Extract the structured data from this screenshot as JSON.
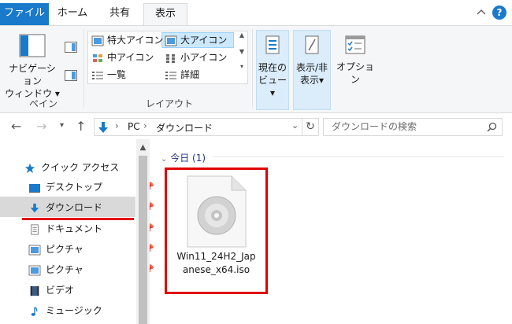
{
  "ribbon_tabs": {
    "file": "ファイル",
    "home": "ホーム",
    "share": "共有",
    "view": "表示"
  },
  "help_label": "?",
  "pane_group": {
    "nav_pane_line1": "ナビゲーション",
    "nav_pane_line2": "ウィンドウ",
    "label": "ペイン"
  },
  "layout_group": {
    "extra_large_icons": "特大アイコン",
    "large_icons": "大アイコン",
    "medium_icons": "中アイコン",
    "small_icons": "小アイコン",
    "list": "一覧",
    "details": "詳細",
    "label": "レイアウト"
  },
  "current_view": {
    "line1": "現在の",
    "line2": "ビュー"
  },
  "show_hide": {
    "line1": "表示/非",
    "line2": "表示"
  },
  "options_label": "オプション",
  "address": {
    "pc": "PC",
    "folder": "ダウンロード"
  },
  "search": {
    "placeholder": "ダウンロードの検索"
  },
  "nav_pane": {
    "quick_access": "クイック アクセス",
    "items": [
      {
        "label": "デスクトップ",
        "icon": "desktop-icon"
      },
      {
        "label": "ダウンロード",
        "icon": "download-icon"
      },
      {
        "label": "ドキュメント",
        "icon": "document-icon"
      },
      {
        "label": "ピクチャ",
        "icon": "pictures-icon"
      },
      {
        "label": "ピクチャ",
        "icon": "pictures-icon"
      },
      {
        "label": "ビデオ",
        "icon": "video-icon"
      },
      {
        "label": "ミュージック",
        "icon": "music-icon"
      }
    ]
  },
  "file_area": {
    "group_header": "今日 (1)",
    "files": [
      {
        "name_line1": "Win11_24H2_Jap",
        "name_line2": "anese_x64.iso",
        "icon": "disc-image-icon"
      }
    ]
  },
  "colors": {
    "accent": "#1979ca",
    "selection": "#cce8ff",
    "highlight_red": "#e30000"
  }
}
